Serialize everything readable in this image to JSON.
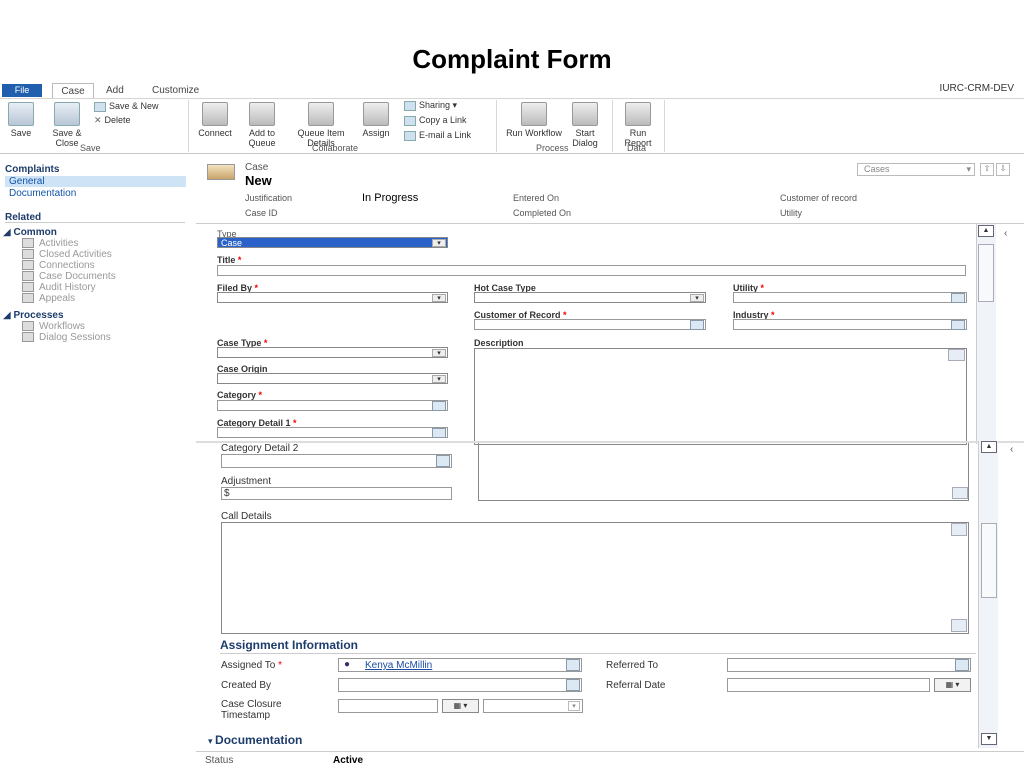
{
  "slide": {
    "title": "Complaint Form"
  },
  "tabs": {
    "file": "File",
    "case": "Case",
    "add": "Add",
    "customize": "Customize",
    "org": "IURC-CRM-DEV"
  },
  "ribbon": {
    "save": "Save",
    "save_close": "Save & Close",
    "save_new": "Save & New",
    "delete": "Delete",
    "group_save": "Save",
    "connect": "Connect",
    "add_queue": "Add to Queue",
    "queue_item": "Queue Item Details",
    "assign": "Assign",
    "sharing": "Sharing",
    "copy_link": "Copy a Link",
    "email_link": "E-mail a Link",
    "group_collab": "Collaborate",
    "run_workflow": "Run Workflow",
    "start_dialog": "Start Dialog",
    "group_process": "Process",
    "run_report": "Run Report",
    "group_data": "Data"
  },
  "nav": {
    "complaints": "Complaints",
    "general": "General",
    "documentation": "Documentation",
    "related": "Related",
    "common": "Common",
    "common_items": [
      "Activities",
      "Closed Activities",
      "Connections",
      "Case Documents",
      "Audit History",
      "Appeals"
    ],
    "processes": "Processes",
    "process_items": [
      "Workflows",
      "Dialog Sessions"
    ]
  },
  "header": {
    "entity": "Case",
    "record": "New",
    "view_select": "Cases",
    "justification_label": "Justification",
    "justification_value": "In Progress",
    "entered_label": "Entered On",
    "customer_label": "Customer of record",
    "caseid_label": "Case ID",
    "completed_label": "Completed On",
    "utility_label": "Utility"
  },
  "form": {
    "type_label": "Type",
    "type_value": "Case",
    "title_label": "Title",
    "filed_by_label": "Filed By",
    "hot_case_label": "Hot Case Type",
    "utility_label": "Utility",
    "customer_record_label": "Customer of Record",
    "industry_label": "Industry",
    "case_type_label": "Case Type",
    "description_label": "Description",
    "case_origin_label": "Case Origin",
    "category_label": "Category",
    "category_detail1_label": "Category Detail 1",
    "category_detail2_label": "Category Detail 2",
    "adjustment_label": "Adjustment",
    "adjustment_value": "$",
    "call_details_label": "Call Details",
    "assignment_section": "Assignment Information",
    "assigned_to_label": "Assigned To",
    "assigned_to_value": "Kenya McMillin",
    "referred_to_label": "Referred To",
    "created_by_label": "Created By",
    "referral_date_label": "Referral Date",
    "closure_label": "Case Closure Timestamp",
    "documentation_section": "Documentation"
  },
  "status": {
    "label": "Status",
    "value": "Active"
  }
}
